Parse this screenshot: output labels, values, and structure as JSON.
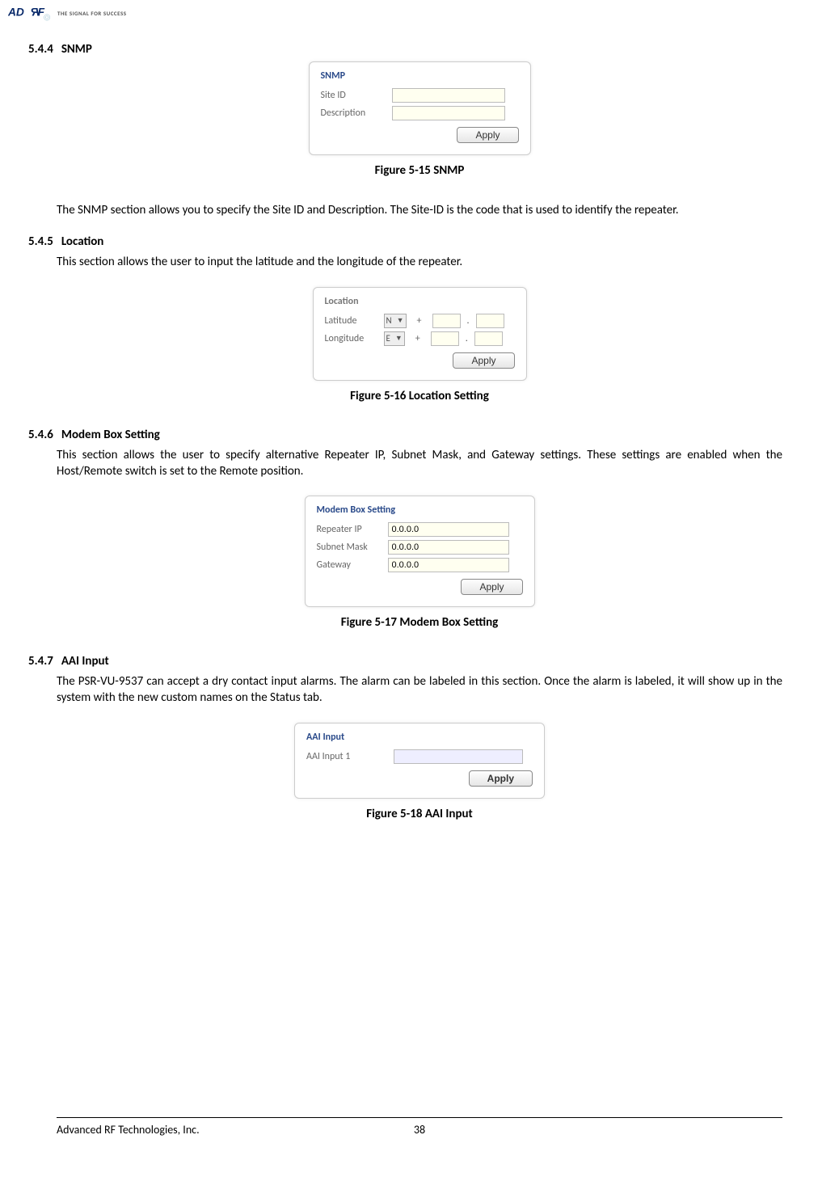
{
  "logo_tagline": "THE SIGNAL FOR SUCCESS",
  "sections": {
    "snmp": {
      "num": "5.4.4",
      "title": "SNMP",
      "panel": {
        "title": "SNMP",
        "site_id_label": "Site ID",
        "description_label": "Description",
        "apply": "Apply"
      },
      "caption": "Figure 5-15    SNMP",
      "body": "The SNMP section allows you to specify the Site ID and Description.  The Site-ID is the code that is used to identify the repeater."
    },
    "location": {
      "num": "5.4.5",
      "title": "Location",
      "body": "This section allows the user to input the latitude and the longitude of the repeater.",
      "panel": {
        "title": "Location",
        "lat_label": "Latitude",
        "lon_label": "Longitude",
        "lat_dir": "N",
        "lon_dir": "E",
        "plus": "+",
        "dot": ".",
        "apply": "Apply"
      },
      "caption": "Figure 5-16    Location Setting"
    },
    "modem": {
      "num": "5.4.6",
      "title": "Modem Box Setting",
      "body": "This section allows the user to specify alternative Repeater IP, Subnet Mask, and Gateway settings.  These settings are enabled when the Host/Remote switch is set to the Remote position.",
      "panel": {
        "title": "Modem Box Setting",
        "ip_label": "Repeater IP",
        "mask_label": "Subnet Mask",
        "gw_label": "Gateway",
        "val": "0.0.0.0",
        "apply": "Apply"
      },
      "caption": "Figure 5-17    Modem Box Setting"
    },
    "aai": {
      "num": "5.4.7",
      "title": "AAI Input",
      "body": "The PSR-VU-9537 can accept a dry contact input alarms.  The alarm can be labeled in this section.  Once the alarm is labeled, it will show up in the system with the new custom names on the Status tab.",
      "panel": {
        "title": "AAI Input",
        "label1": "AAI Input 1",
        "apply": "Apply"
      },
      "caption": "Figure 5-18    AAI Input"
    }
  },
  "footer": {
    "left": "Advanced RF Technologies, Inc.",
    "page": "38"
  }
}
